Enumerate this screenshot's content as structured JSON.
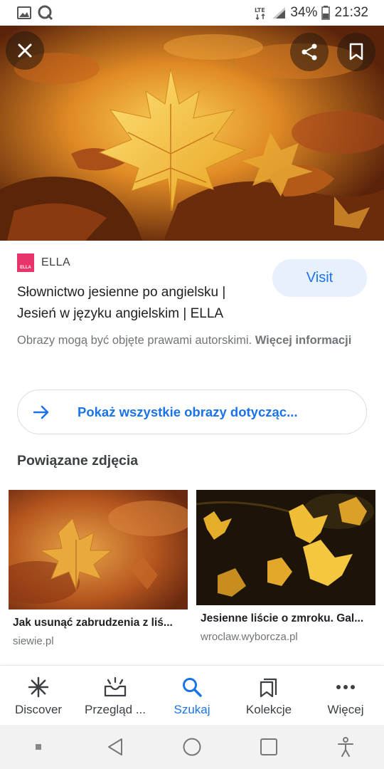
{
  "status_bar": {
    "battery": "34%",
    "time": "21:32",
    "network": "LTE"
  },
  "hero": {
    "icons": {
      "close": "close-icon",
      "share": "share-icon",
      "save": "bookmark-icon"
    }
  },
  "result": {
    "source_name": "ELLA",
    "source_logo_text": "ELLA",
    "visit_label": "Visit",
    "title": "Słownictwo jesienne po angielsku | Jesień w języku angielskim | ELLA",
    "copyright_text": "Obrazy mogą być objęte prawami autorskimi. ",
    "copyright_link": "Więcej informacji",
    "show_all_label": "Pokaż wszystkie obrazy dotycząc..."
  },
  "related": {
    "heading": "Powiązane zdjęcia",
    "cards": [
      {
        "title": "Jak usunąć zabrudzenia z liś...",
        "source": "siewie.pl"
      },
      {
        "title": "Jesienne liście o zmroku. Gal...",
        "source": "wroclaw.wyborcza.pl"
      }
    ]
  },
  "bottom_nav": [
    {
      "label": "Discover",
      "icon": "asterisk-icon"
    },
    {
      "label": "Przegląd ...",
      "icon": "updates-icon"
    },
    {
      "label": "Szukaj",
      "icon": "search-icon",
      "active": true
    },
    {
      "label": "Kolekcje",
      "icon": "collections-icon"
    },
    {
      "label": "Więcej",
      "icon": "more-icon"
    }
  ],
  "colors": {
    "accent": "#1a73e8",
    "visit_bg": "#e8f0fe",
    "logo": "#e8336b"
  }
}
